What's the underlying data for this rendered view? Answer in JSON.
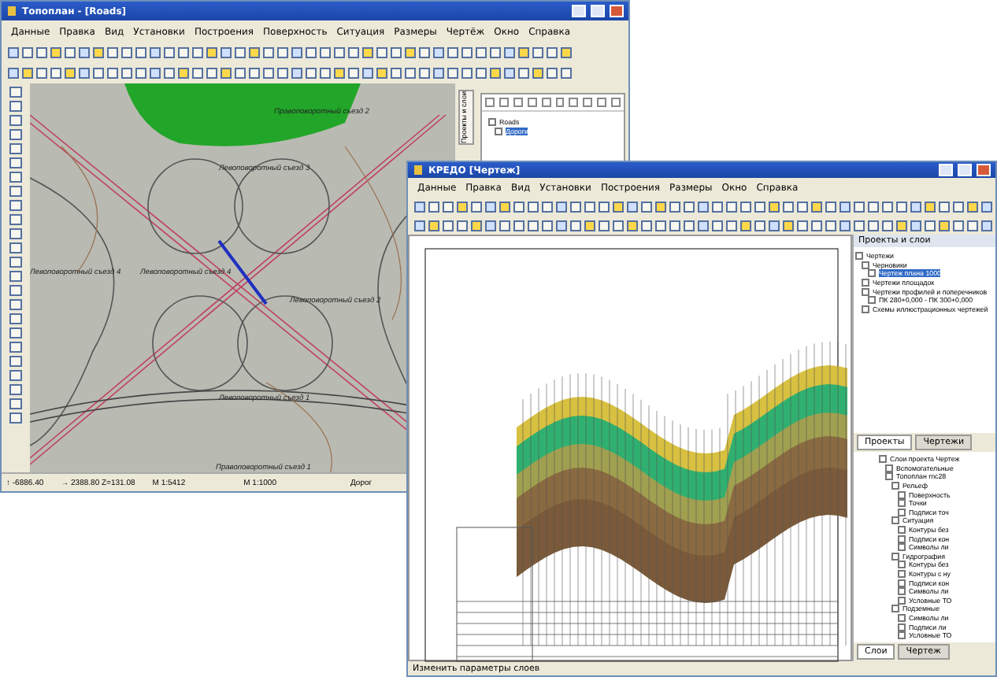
{
  "left_window": {
    "title": "Топоплан - [Roads]",
    "menu": [
      "Данные",
      "Правка",
      "Вид",
      "Установки",
      "Построения",
      "Поверхность",
      "Ситуация",
      "Размеры",
      "Чертёж",
      "Окно",
      "Справка"
    ],
    "map_labels": [
      "Правоповоротный съезд 2",
      "Левоповоротный съезд 3",
      "Левоповоротный съезд 4",
      "Левоповоротный съезд 4",
      "Левоповоротный съезд 2",
      "Левоповоротный съезд 1",
      "Правоповоротный съезд 1"
    ],
    "side_tab": "Проекты и слои",
    "tree": [
      {
        "label": "Roads",
        "children": [
          {
            "label": "Дороги",
            "selected": true
          }
        ]
      }
    ],
    "status_bar": [
      "↑ -6886.40",
      "→ 2388.80 Z=131.08",
      "М 1:5412",
      "М 1:1000",
      "Дорог"
    ]
  },
  "right_window": {
    "title": "КРЕДО [Чертеж]",
    "menu": [
      "Данные",
      "Правка",
      "Вид",
      "Установки",
      "Построения",
      "Размеры",
      "Окно",
      "Справка"
    ],
    "panel_title": "Проекты и слои",
    "tree": [
      {
        "label": "Чертежи",
        "children": [
          {
            "label": "Черновики",
            "children": [
              {
                "label": "Чертеж плана 1000",
                "selected": true
              }
            ]
          },
          {
            "label": "Чертежи площадок"
          },
          {
            "label": "Чертежи профилей и поперечников",
            "children": [
              {
                "label": "ПК 280+0,000 - ПК 300+0,000",
                "selected": false
              }
            ]
          },
          {
            "label": "Схемы иллюстрационных чертежей"
          }
        ]
      }
    ],
    "tabs": [
      {
        "label": "Проекты",
        "selected": true
      },
      {
        "label": "Чертежи",
        "selected": false
      }
    ],
    "layers": [
      {
        "label": "Слои проекта Чертеж",
        "children": [
          {
            "label": "Вспомогательные"
          },
          {
            "label": "Топоплан rnc28",
            "children": [
              {
                "label": "Рельеф",
                "children": [
                  {
                    "label": "Поверхность"
                  },
                  {
                    "label": "Точки"
                  },
                  {
                    "label": "Подписи точ"
                  }
                ]
              },
              {
                "label": "Ситуация",
                "children": [
                  {
                    "label": "Контуры без"
                  },
                  {
                    "label": "Подписи кон"
                  },
                  {
                    "label": "Символы ли"
                  }
                ]
              },
              {
                "label": "Гидрография",
                "children": [
                  {
                    "label": "Контуры без"
                  },
                  {
                    "label": "Контуры с ну"
                  },
                  {
                    "label": "Подписи кон"
                  },
                  {
                    "label": "Символы ли"
                  },
                  {
                    "label": "Условные ТО"
                  }
                ]
              },
              {
                "label": "Подземные",
                "children": [
                  {
                    "label": "Символы ли"
                  },
                  {
                    "label": "Подписи ли"
                  },
                  {
                    "label": "Условные ТО"
                  }
                ]
              }
            ]
          }
        ]
      }
    ],
    "bottom_tabs": [
      {
        "label": "Слои",
        "selected": true
      },
      {
        "label": "Чертеж",
        "selected": false
      }
    ],
    "status_bar": "Изменить параметры слоев"
  }
}
